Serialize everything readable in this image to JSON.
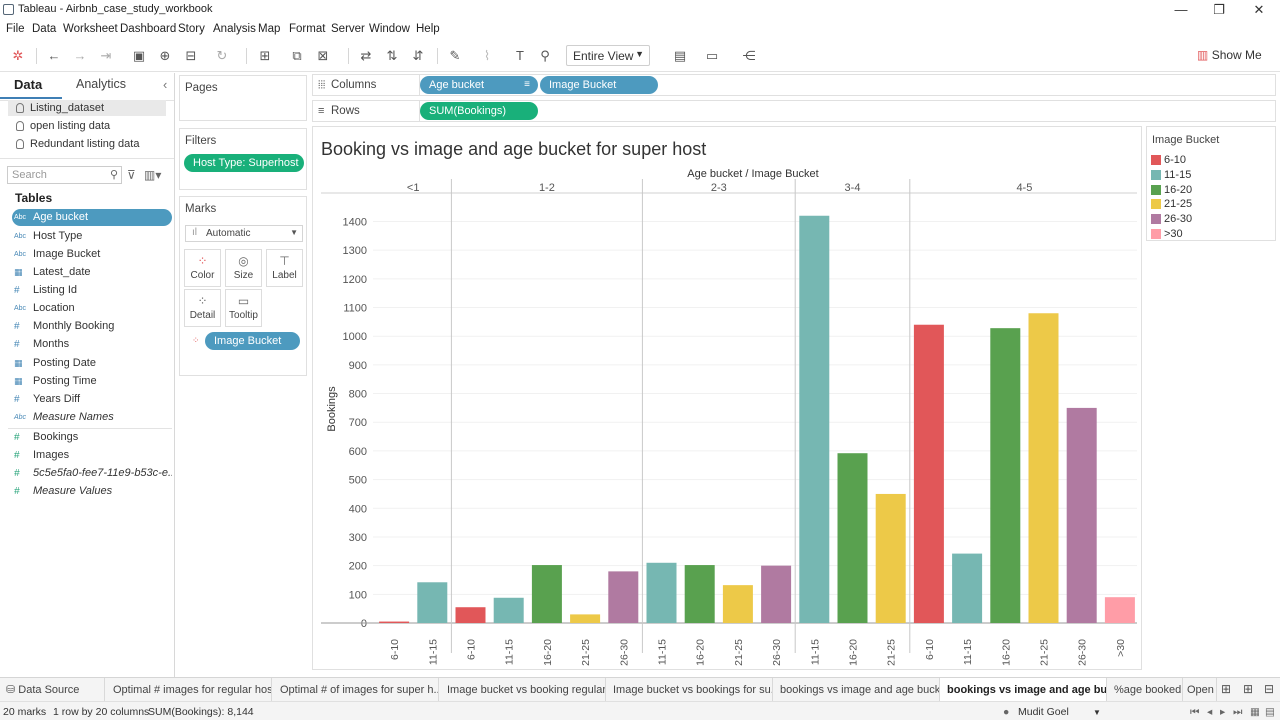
{
  "window": {
    "title": "Tableau - Airbnb_case_study_workbook",
    "minimize": "—",
    "maximize": "❐",
    "close": "✕"
  },
  "menu": [
    "File",
    "Data",
    "Worksheet",
    "Dashboard",
    "Story",
    "Analysis",
    "Map",
    "Format",
    "Server",
    "Window",
    "Help"
  ],
  "toolbar": {
    "fit_value": "Entire View",
    "show_me": "Show Me"
  },
  "left_panel": {
    "tab_data": "Data",
    "tab_analytics": "Analytics",
    "collapse": "‹",
    "datasources": [
      "Listing_dataset",
      "open listing data",
      "Redundant listing data"
    ],
    "search_placeholder": "Search",
    "tables_heading": "Tables",
    "dimensions": [
      {
        "type": "Abc",
        "name": "Age bucket"
      },
      {
        "type": "Abc",
        "name": "Host Type"
      },
      {
        "type": "Abc",
        "name": "Image Bucket"
      },
      {
        "type": "▦",
        "name": "Latest_date"
      },
      {
        "type": "#",
        "name": "Listing Id"
      },
      {
        "type": "Abc",
        "name": "Location"
      },
      {
        "type": "#",
        "name": "Monthly Booking"
      },
      {
        "type": "#",
        "name": "Months"
      },
      {
        "type": "▦",
        "name": "Posting Date"
      },
      {
        "type": "▦",
        "name": "Posting Time"
      },
      {
        "type": "#",
        "name": "Years Diff"
      },
      {
        "type": "Abc",
        "name": "Measure Names"
      }
    ],
    "measures": [
      {
        "type": "#",
        "name": "Bookings"
      },
      {
        "type": "#",
        "name": "Images"
      },
      {
        "type": "#",
        "name": "5c5e5fa0-fee7-11e9-b53c-e..."
      },
      {
        "type": "#",
        "name": "Measure Values"
      }
    ]
  },
  "shelves": {
    "pages_label": "Pages",
    "filters_label": "Filters",
    "filter_pill": "Host Type: Superhost",
    "marks_label": "Marks",
    "mark_type": "Automatic",
    "mark_buttons": [
      "Color",
      "Size",
      "Label",
      "Detail",
      "Tooltip"
    ],
    "marks_pill": "Image Bucket",
    "columns_label": "Columns",
    "rows_label": "Rows",
    "columns_pills": [
      "Age bucket",
      "Image Bucket"
    ],
    "rows_pill": "SUM(Bookings)"
  },
  "legend": {
    "title": "Image Bucket",
    "items": [
      {
        "label": "6-10",
        "color": "#e15759"
      },
      {
        "label": "11-15",
        "color": "#76b7b2"
      },
      {
        "label": "16-20",
        "color": "#59a14f"
      },
      {
        "label": "21-25",
        "color": "#edc948"
      },
      {
        "label": "26-30",
        "color": "#b07aa1"
      },
      {
        "label": ">30",
        "color": "#ff9da7"
      }
    ]
  },
  "chart_data": {
    "type": "bar",
    "title": "Booking vs image and age bucket for super host",
    "header": "Age bucket  /  Image Bucket",
    "ylabel": "Bookings",
    "ylim": [
      0,
      1500
    ],
    "yticks": [
      0,
      100,
      200,
      300,
      400,
      500,
      600,
      700,
      800,
      900,
      1000,
      1100,
      1200,
      1300,
      1400
    ],
    "groups": [
      {
        "name": "<1",
        "bars": [
          {
            "cat": "6-10",
            "value": 5
          },
          {
            "cat": "11-15",
            "value": 142
          }
        ]
      },
      {
        "name": "1-2",
        "bars": [
          {
            "cat": "6-10",
            "value": 55
          },
          {
            "cat": "11-15",
            "value": 88
          },
          {
            "cat": "16-20",
            "value": 202
          },
          {
            "cat": "21-25",
            "value": 30
          },
          {
            "cat": "26-30",
            "value": 180
          }
        ]
      },
      {
        "name": "2-3",
        "bars": [
          {
            "cat": "11-15",
            "value": 210
          },
          {
            "cat": "16-20",
            "value": 202
          },
          {
            "cat": "21-25",
            "value": 132
          },
          {
            "cat": "26-30",
            "value": 200
          }
        ]
      },
      {
        "name": "3-4",
        "bars": [
          {
            "cat": "11-15",
            "value": 1420
          },
          {
            "cat": "16-20",
            "value": 592
          },
          {
            "cat": "21-25",
            "value": 450
          }
        ]
      },
      {
        "name": "4-5",
        "bars": [
          {
            "cat": "6-10",
            "value": 1040
          },
          {
            "cat": "11-15",
            "value": 242
          },
          {
            "cat": "16-20",
            "value": 1028
          },
          {
            "cat": "21-25",
            "value": 1080
          },
          {
            "cat": "26-30",
            "value": 750
          },
          {
            "cat": ">30",
            "value": 90
          }
        ]
      }
    ]
  },
  "sheet_tabs": [
    {
      "label": "Data Source",
      "active": false
    },
    {
      "label": "Optimal # images for regular hosr",
      "active": false
    },
    {
      "label": "Optimal # of images for super h...",
      "active": false
    },
    {
      "label": "Image bucket vs booking regular...",
      "active": false
    },
    {
      "label": "Image bucket vs bookings for su...",
      "active": false
    },
    {
      "label": "bookings vs image and age bucket",
      "active": false
    },
    {
      "label": "bookings vs image and age buc...",
      "active": true
    },
    {
      "label": "%age booked",
      "active": false
    },
    {
      "label": "Open",
      "active": false
    }
  ],
  "status": {
    "marks": "20 marks",
    "dims": "1 row by 20 columns",
    "sum": "SUM(Bookings): 8,144",
    "user": "Mudit Goel"
  }
}
